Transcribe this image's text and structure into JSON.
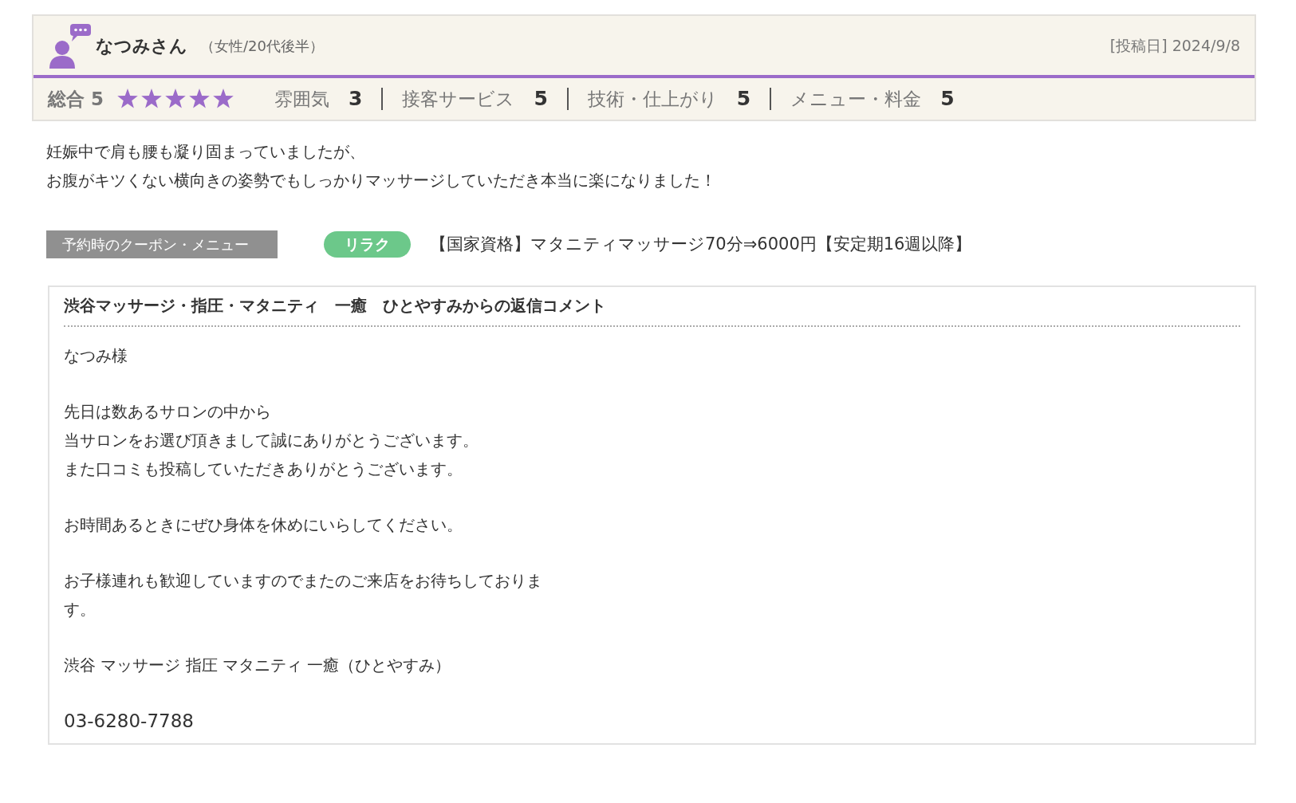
{
  "reviewer": {
    "name": "なつみさん",
    "attributes": "（女性/20代後半）",
    "posted": "[投稿日] 2024/9/8"
  },
  "overall": {
    "label": "総合",
    "score": "5",
    "stars": 5
  },
  "categories": [
    {
      "label": "雰囲気",
      "score": "3"
    },
    {
      "label": "接客サービス",
      "score": "5"
    },
    {
      "label": "技術・仕上がり",
      "score": "5"
    },
    {
      "label": "メニュー・料金",
      "score": "5"
    }
  ],
  "review_lines": [
    "妊娠中で肩も腰も凝り固まっていましたが、",
    "お腹がキツくない横向きの姿勢でもしっかりマッサージしていただき本当に楽になりました！"
  ],
  "coupon": {
    "label": "予約時のクーポン・メニュー",
    "tag": "リラク",
    "title": "【国家資格】マタニティマッサージ70分⇒6000円【安定期16週以降】"
  },
  "reply": {
    "title": "渋谷マッサージ・指圧・マタニティ　一癒　ひとやすみからの返信コメント",
    "paragraphs": [
      [
        "なつみ様"
      ],
      [
        "先日は数あるサロンの中から",
        "当サロンをお選び頂きまして誠にありがとうございます。",
        "また口コミも投稿していただきありがとうございます。"
      ],
      [
        "お時間あるときにぜひ身体を休めにいらしてください。"
      ],
      [
        "お子様連れも歓迎していますのでまたのご来店をお待ちしておりま",
        "す。"
      ],
      [
        "渋谷 マッサージ 指圧 マタニティ 一癒（ひとやすみ）"
      ],
      [
        "03-6280-7788"
      ]
    ]
  }
}
